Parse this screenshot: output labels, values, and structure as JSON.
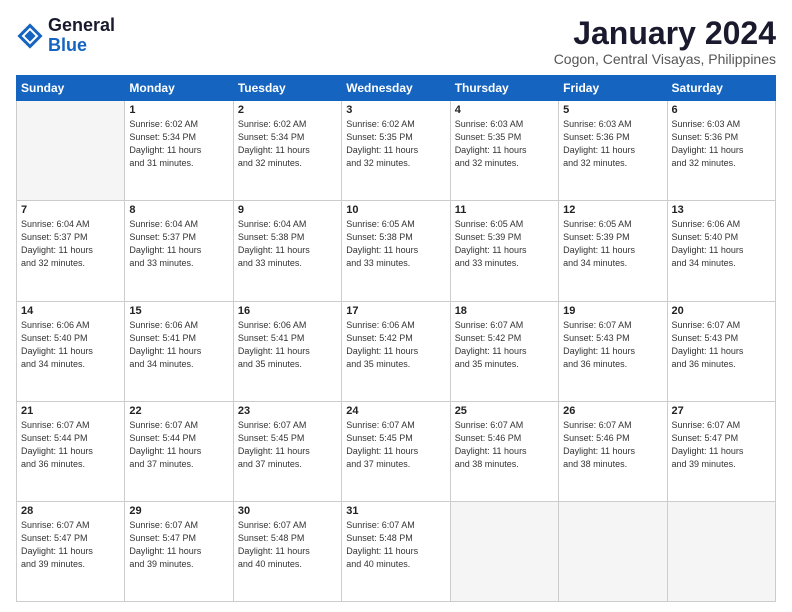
{
  "logo": {
    "line1": "General",
    "line2": "Blue"
  },
  "title": "January 2024",
  "subtitle": "Cogon, Central Visayas, Philippines",
  "days_header": [
    "Sunday",
    "Monday",
    "Tuesday",
    "Wednesday",
    "Thursday",
    "Friday",
    "Saturday"
  ],
  "weeks": [
    [
      {
        "day": "",
        "info": ""
      },
      {
        "day": "1",
        "info": "Sunrise: 6:02 AM\nSunset: 5:34 PM\nDaylight: 11 hours\nand 31 minutes."
      },
      {
        "day": "2",
        "info": "Sunrise: 6:02 AM\nSunset: 5:34 PM\nDaylight: 11 hours\nand 32 minutes."
      },
      {
        "day": "3",
        "info": "Sunrise: 6:02 AM\nSunset: 5:35 PM\nDaylight: 11 hours\nand 32 minutes."
      },
      {
        "day": "4",
        "info": "Sunrise: 6:03 AM\nSunset: 5:35 PM\nDaylight: 11 hours\nand 32 minutes."
      },
      {
        "day": "5",
        "info": "Sunrise: 6:03 AM\nSunset: 5:36 PM\nDaylight: 11 hours\nand 32 minutes."
      },
      {
        "day": "6",
        "info": "Sunrise: 6:03 AM\nSunset: 5:36 PM\nDaylight: 11 hours\nand 32 minutes."
      }
    ],
    [
      {
        "day": "7",
        "info": "Sunrise: 6:04 AM\nSunset: 5:37 PM\nDaylight: 11 hours\nand 32 minutes."
      },
      {
        "day": "8",
        "info": "Sunrise: 6:04 AM\nSunset: 5:37 PM\nDaylight: 11 hours\nand 33 minutes."
      },
      {
        "day": "9",
        "info": "Sunrise: 6:04 AM\nSunset: 5:38 PM\nDaylight: 11 hours\nand 33 minutes."
      },
      {
        "day": "10",
        "info": "Sunrise: 6:05 AM\nSunset: 5:38 PM\nDaylight: 11 hours\nand 33 minutes."
      },
      {
        "day": "11",
        "info": "Sunrise: 6:05 AM\nSunset: 5:39 PM\nDaylight: 11 hours\nand 33 minutes."
      },
      {
        "day": "12",
        "info": "Sunrise: 6:05 AM\nSunset: 5:39 PM\nDaylight: 11 hours\nand 34 minutes."
      },
      {
        "day": "13",
        "info": "Sunrise: 6:06 AM\nSunset: 5:40 PM\nDaylight: 11 hours\nand 34 minutes."
      }
    ],
    [
      {
        "day": "14",
        "info": "Sunrise: 6:06 AM\nSunset: 5:40 PM\nDaylight: 11 hours\nand 34 minutes."
      },
      {
        "day": "15",
        "info": "Sunrise: 6:06 AM\nSunset: 5:41 PM\nDaylight: 11 hours\nand 34 minutes."
      },
      {
        "day": "16",
        "info": "Sunrise: 6:06 AM\nSunset: 5:41 PM\nDaylight: 11 hours\nand 35 minutes."
      },
      {
        "day": "17",
        "info": "Sunrise: 6:06 AM\nSunset: 5:42 PM\nDaylight: 11 hours\nand 35 minutes."
      },
      {
        "day": "18",
        "info": "Sunrise: 6:07 AM\nSunset: 5:42 PM\nDaylight: 11 hours\nand 35 minutes."
      },
      {
        "day": "19",
        "info": "Sunrise: 6:07 AM\nSunset: 5:43 PM\nDaylight: 11 hours\nand 36 minutes."
      },
      {
        "day": "20",
        "info": "Sunrise: 6:07 AM\nSunset: 5:43 PM\nDaylight: 11 hours\nand 36 minutes."
      }
    ],
    [
      {
        "day": "21",
        "info": "Sunrise: 6:07 AM\nSunset: 5:44 PM\nDaylight: 11 hours\nand 36 minutes."
      },
      {
        "day": "22",
        "info": "Sunrise: 6:07 AM\nSunset: 5:44 PM\nDaylight: 11 hours\nand 37 minutes."
      },
      {
        "day": "23",
        "info": "Sunrise: 6:07 AM\nSunset: 5:45 PM\nDaylight: 11 hours\nand 37 minutes."
      },
      {
        "day": "24",
        "info": "Sunrise: 6:07 AM\nSunset: 5:45 PM\nDaylight: 11 hours\nand 37 minutes."
      },
      {
        "day": "25",
        "info": "Sunrise: 6:07 AM\nSunset: 5:46 PM\nDaylight: 11 hours\nand 38 minutes."
      },
      {
        "day": "26",
        "info": "Sunrise: 6:07 AM\nSunset: 5:46 PM\nDaylight: 11 hours\nand 38 minutes."
      },
      {
        "day": "27",
        "info": "Sunrise: 6:07 AM\nSunset: 5:47 PM\nDaylight: 11 hours\nand 39 minutes."
      }
    ],
    [
      {
        "day": "28",
        "info": "Sunrise: 6:07 AM\nSunset: 5:47 PM\nDaylight: 11 hours\nand 39 minutes."
      },
      {
        "day": "29",
        "info": "Sunrise: 6:07 AM\nSunset: 5:47 PM\nDaylight: 11 hours\nand 39 minutes."
      },
      {
        "day": "30",
        "info": "Sunrise: 6:07 AM\nSunset: 5:48 PM\nDaylight: 11 hours\nand 40 minutes."
      },
      {
        "day": "31",
        "info": "Sunrise: 6:07 AM\nSunset: 5:48 PM\nDaylight: 11 hours\nand 40 minutes."
      },
      {
        "day": "",
        "info": ""
      },
      {
        "day": "",
        "info": ""
      },
      {
        "day": "",
        "info": ""
      }
    ]
  ]
}
